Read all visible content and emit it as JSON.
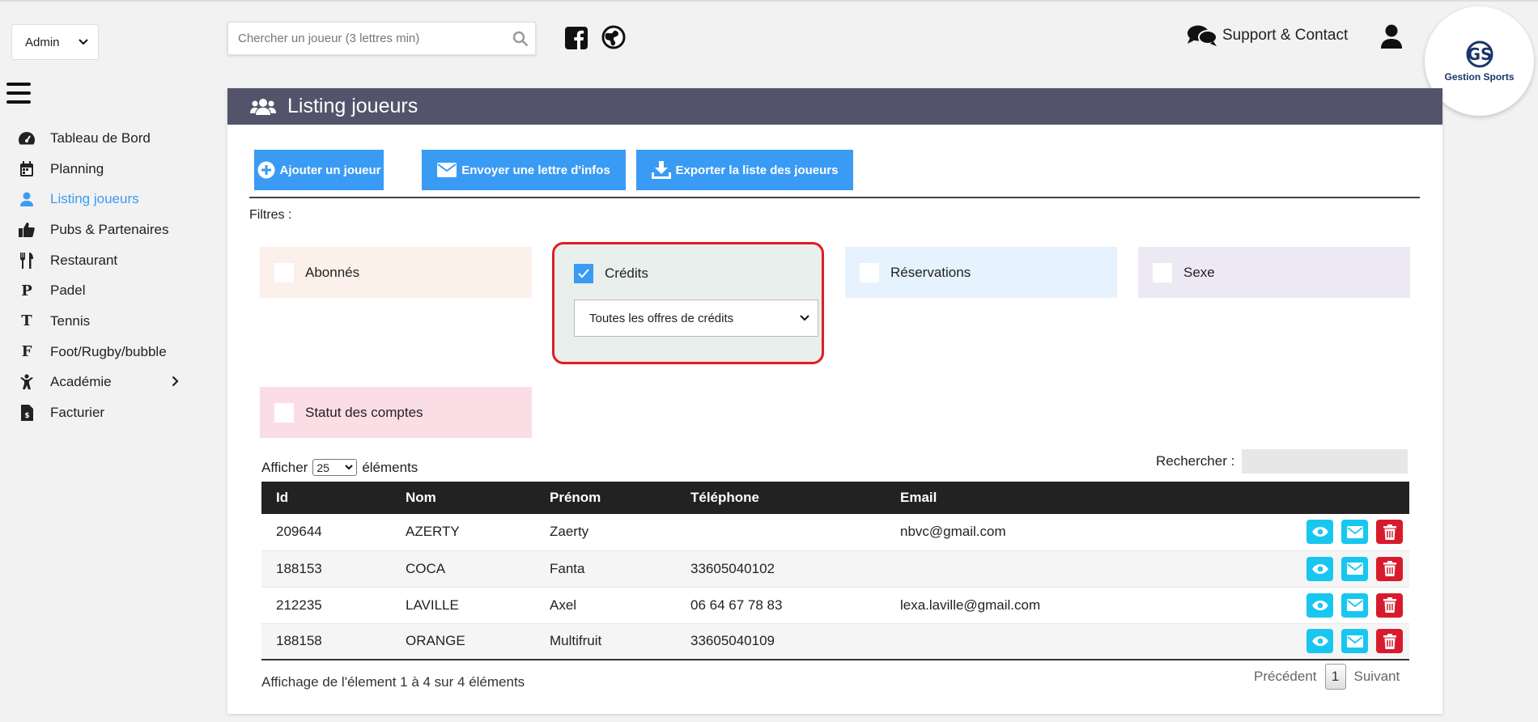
{
  "role": {
    "selected": "Admin"
  },
  "sidebar": {
    "items": [
      {
        "label": "Tableau de Bord",
        "icon": "dashboard-icon"
      },
      {
        "label": "Planning",
        "icon": "calendar-icon"
      },
      {
        "label": "Listing joueurs",
        "icon": "user-icon",
        "active": true
      },
      {
        "label": "Pubs & Partenaires",
        "icon": "thumbs-up-icon"
      },
      {
        "label": "Restaurant",
        "icon": "utensils-icon"
      },
      {
        "label": "Padel",
        "icon": "letter-p-icon",
        "glyph": "P"
      },
      {
        "label": "Tennis",
        "icon": "letter-t-icon",
        "glyph": "T"
      },
      {
        "label": "Foot/Rugby/bubble",
        "icon": "letter-f-icon",
        "glyph": "F"
      },
      {
        "label": "Académie",
        "icon": "child-icon"
      },
      {
        "label": "Facturier",
        "icon": "invoice-icon"
      }
    ]
  },
  "header": {
    "search_placeholder": "Chercher un joueur (3 lettres min)",
    "support_label": "Support & Contact",
    "logo_text": "Gestion Sports"
  },
  "panel": {
    "title": "Listing joueurs",
    "buttons": {
      "add": "Ajouter un joueur",
      "newsletter": "Envoyer une lettre d'infos",
      "export": "Exporter la liste des joueurs"
    },
    "filters_label": "Filtres :",
    "filters": {
      "abonnes": "Abonnés",
      "credits": "Crédits",
      "credits_option": "Toutes les offres de crédits",
      "reservations": "Réservations",
      "sexe": "Sexe",
      "statut": "Statut des comptes"
    }
  },
  "table": {
    "show_prefix": "Afficher",
    "show_value": "25",
    "show_suffix": "éléments",
    "search_label": "Rechercher :",
    "columns": [
      "Id",
      "Nom",
      "Prénom",
      "Téléphone",
      "Email"
    ],
    "rows": [
      {
        "id": "209644",
        "nom": "AZERTY",
        "prenom": "Zaerty",
        "tel": "",
        "email": "nbvc@gmail.com"
      },
      {
        "id": "188153",
        "nom": "COCA",
        "prenom": "Fanta",
        "tel": "33605040102",
        "email": ""
      },
      {
        "id": "212235",
        "nom": "LAVILLE",
        "prenom": "Axel",
        "tel": "06 64 67 78 83",
        "email": "lexa.laville@gmail.com"
      },
      {
        "id": "188158",
        "nom": "ORANGE",
        "prenom": "Multifruit",
        "tel": "33605040109",
        "email": ""
      }
    ],
    "info": "Affichage de l'élement 1 à 4 sur 4 éléments",
    "prev": "Précédent",
    "page": "1",
    "next": "Suivant"
  },
  "colors": {
    "accent": "#3a9bf4",
    "header": "#53546b",
    "highlight": "#e41b23"
  }
}
